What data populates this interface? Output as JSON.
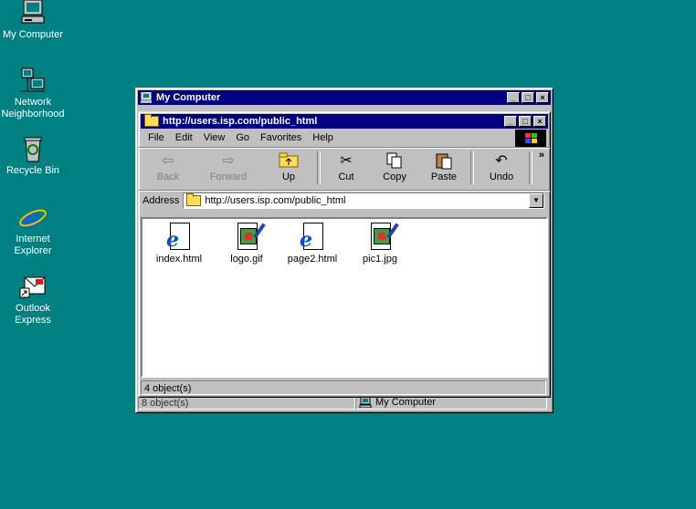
{
  "desktop": {
    "icons": [
      {
        "label": "My Computer",
        "icon": "my-computer-icon"
      },
      {
        "label": "Network\nNeighborhood",
        "icon": "network-neighborhood-icon"
      },
      {
        "label": "Recycle Bin",
        "icon": "recycle-bin-icon"
      },
      {
        "label": "Internet\nExplorer",
        "icon": "internet-explorer-icon"
      },
      {
        "label": "Outlook\nExpress",
        "icon": "outlook-express-icon"
      }
    ],
    "background": "#008080"
  },
  "outer_window": {
    "title": "My Computer",
    "status_objects": "8 object(s)",
    "status_location": "My Computer"
  },
  "inner_window": {
    "title": "http://users.isp.com/public_html",
    "menu": [
      "File",
      "Edit",
      "View",
      "Go",
      "Favorites",
      "Help"
    ],
    "toolbar": [
      {
        "label": "Back",
        "icon": "back-arrow-icon",
        "enabled": false
      },
      {
        "label": "Forward",
        "icon": "forward-arrow-icon",
        "enabled": false
      },
      {
        "label": "Up",
        "icon": "up-folder-icon",
        "enabled": true
      },
      {
        "label": "Cut",
        "icon": "scissors-icon",
        "enabled": true
      },
      {
        "label": "Copy",
        "icon": "copy-icon",
        "enabled": true
      },
      {
        "label": "Paste",
        "icon": "paste-icon",
        "enabled": true
      },
      {
        "label": "Undo",
        "icon": "undo-icon",
        "enabled": true
      }
    ],
    "address_label": "Address",
    "address_value": "http://users.isp.com/public_html",
    "files": [
      {
        "name": "index.html",
        "type": "html"
      },
      {
        "name": "logo.gif",
        "type": "image"
      },
      {
        "name": "page2.html",
        "type": "html"
      },
      {
        "name": "pic1.jpg",
        "type": "image"
      }
    ],
    "status": "4 object(s)"
  },
  "colors": {
    "titlebar": "#000080",
    "face": "#c0c0c0"
  }
}
